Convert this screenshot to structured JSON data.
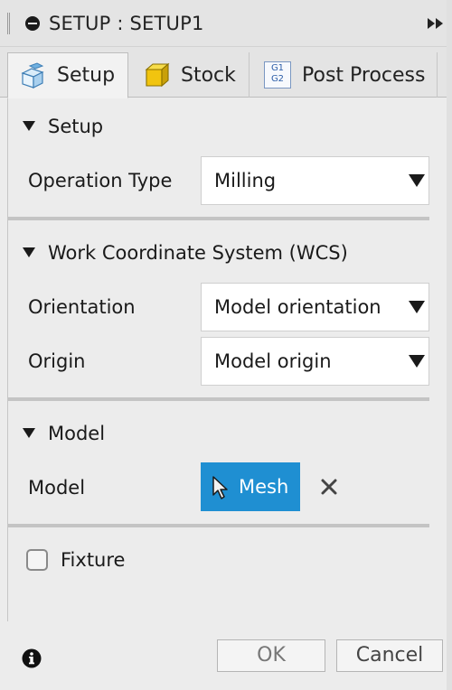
{
  "titlebar": {
    "title": "SETUP : SETUP1",
    "title_icon": "stop-circle-icon",
    "collapse_icon": "fast-forward-icon"
  },
  "tabs": [
    {
      "label": "Setup",
      "icon": "setup-cube-icon",
      "active": true
    },
    {
      "label": "Stock",
      "icon": "stock-box-icon",
      "active": false
    },
    {
      "label": "Post Process",
      "icon": "g1-g2-code-icon",
      "icon_text": [
        "G1",
        "G2"
      ],
      "active": false
    }
  ],
  "sections": {
    "setup": {
      "title": "Setup",
      "operation_type_label": "Operation Type",
      "operation_type_value": "Milling"
    },
    "wcs": {
      "title": "Work Coordinate System (WCS)",
      "orientation_label": "Orientation",
      "orientation_value": "Model orientation",
      "origin_label": "Origin",
      "origin_value": "Model origin"
    },
    "model": {
      "title": "Model",
      "model_label": "Model",
      "model_button": "Mesh"
    },
    "fixture": {
      "label": "Fixture",
      "checked": false
    }
  },
  "footer": {
    "ok_label": "OK",
    "cancel_label": "Cancel",
    "info_icon": "info-icon"
  },
  "colors": {
    "accent": "#1f8fd2",
    "background": "#ececec"
  }
}
